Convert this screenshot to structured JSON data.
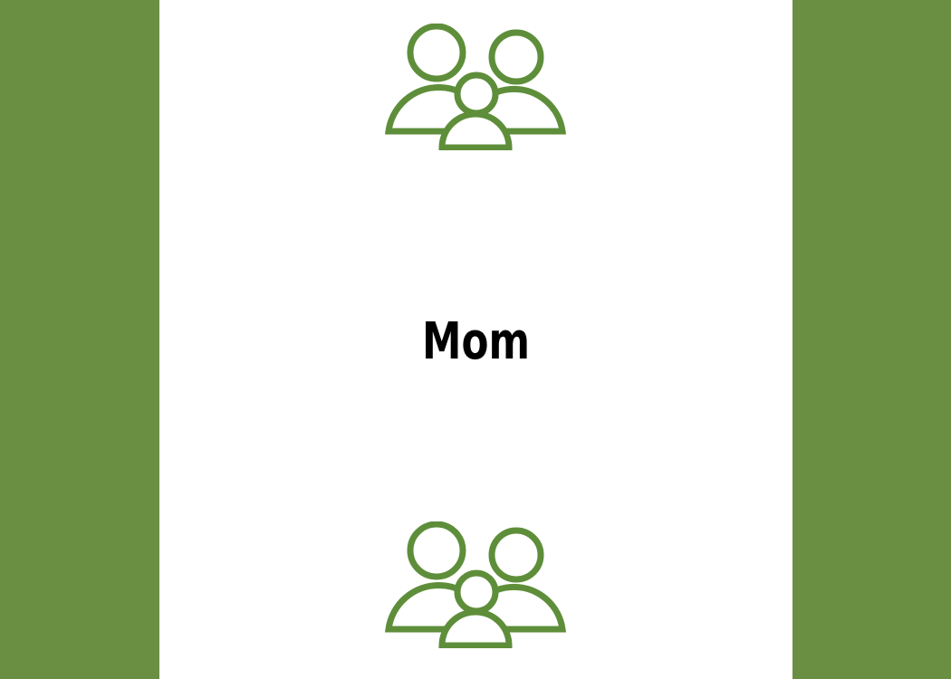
{
  "card": {
    "label": "Mom"
  },
  "icons": {
    "top": "family-icon",
    "bottom": "family-icon"
  },
  "colors": {
    "side_panel": "#6a8f43",
    "icon_stroke": "#5e8e3a",
    "card_background": "#ffffff",
    "label_text": "#000000"
  }
}
